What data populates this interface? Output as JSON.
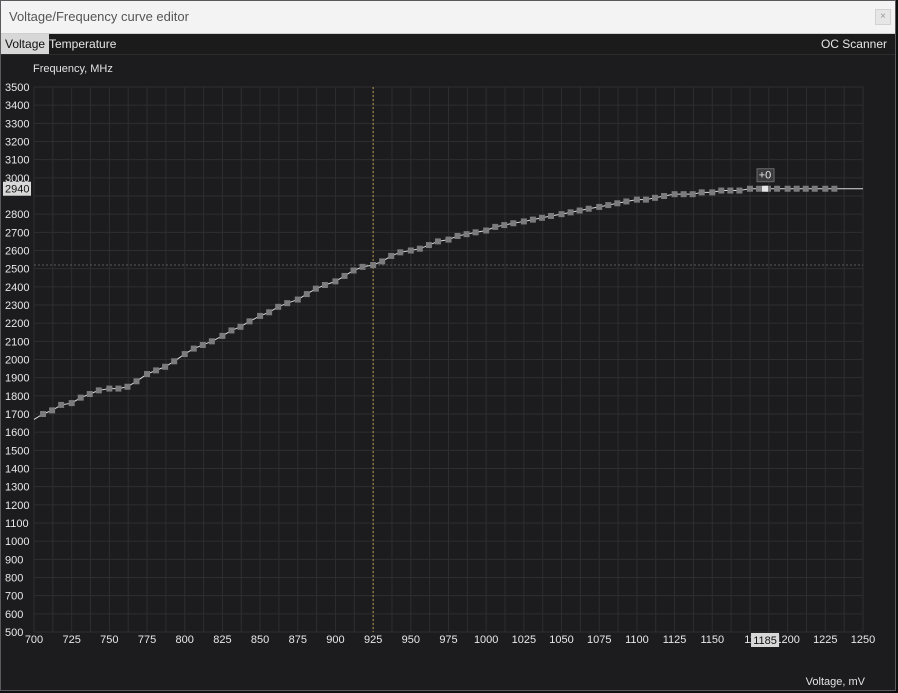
{
  "window": {
    "title": "Voltage/Frequency curve editor",
    "close_glyph": "×"
  },
  "tabs": [
    {
      "label": "Voltage",
      "active": true
    },
    {
      "label": "Temperature",
      "active": false
    }
  ],
  "oc_scanner": {
    "label": "OC Scanner"
  },
  "colors": {
    "background": "#1c1c1e",
    "grid": "#2e2e31",
    "curve": "#d9d9d9",
    "point": "#7b7b7d",
    "selected_point": "#e6e6e6",
    "crosshair": "#b4964a"
  },
  "chart_data": {
    "type": "line",
    "xlabel": "Voltage, mV",
    "ylabel": "Frequency, MHz",
    "xlim": [
      700,
      1250
    ],
    "ylim": [
      500,
      3500
    ],
    "x_ticks": [
      700,
      725,
      750,
      775,
      800,
      825,
      850,
      875,
      900,
      925,
      950,
      975,
      1000,
      1025,
      1050,
      1075,
      1100,
      1125,
      1150,
      1175,
      1200,
      1225,
      1250
    ],
    "x_tick_labels": [
      "700",
      "725",
      "750",
      "775",
      "800",
      "825",
      "850",
      "875",
      "900",
      "925",
      "950",
      "975",
      "1000",
      "1025",
      "1050",
      "1075",
      "1100",
      "1125",
      "1150",
      "11",
      "1200",
      "1225",
      "1250"
    ],
    "y_ticks": [
      500,
      600,
      700,
      800,
      900,
      1000,
      1100,
      1200,
      1300,
      1400,
      1500,
      1600,
      1700,
      1800,
      1900,
      2000,
      2100,
      2200,
      2300,
      2400,
      2500,
      2600,
      2700,
      2800,
      2900,
      3000,
      3100,
      3200,
      3300,
      3400,
      3500
    ],
    "grid": true,
    "x": [
      700,
      706,
      712,
      718,
      725,
      731,
      737,
      743,
      750,
      756,
      762,
      768,
      775,
      781,
      787,
      793,
      800,
      806,
      812,
      818,
      825,
      831,
      837,
      843,
      850,
      856,
      862,
      868,
      875,
      881,
      887,
      893,
      900,
      906,
      912,
      918,
      925,
      931,
      937,
      943,
      950,
      956,
      962,
      968,
      975,
      981,
      987,
      993,
      1000,
      1006,
      1012,
      1018,
      1025,
      1031,
      1037,
      1043,
      1050,
      1056,
      1062,
      1068,
      1075,
      1081,
      1087,
      1093,
      1100,
      1106,
      1112,
      1118,
      1125,
      1131,
      1137,
      1143,
      1150,
      1156,
      1162,
      1168,
      1175,
      1181,
      1187,
      1193,
      1200,
      1206,
      1212,
      1218,
      1225,
      1231,
      1237,
      1243,
      1250
    ],
    "y": [
      1670,
      1700,
      1720,
      1750,
      1760,
      1790,
      1810,
      1830,
      1840,
      1840,
      1850,
      1880,
      1920,
      1940,
      1960,
      1990,
      2030,
      2060,
      2080,
      2100,
      2130,
      2160,
      2180,
      2210,
      2240,
      2260,
      2290,
      2310,
      2330,
      2360,
      2390,
      2410,
      2430,
      2460,
      2490,
      2510,
      2520,
      2540,
      2570,
      2590,
      2600,
      2610,
      2630,
      2650,
      2660,
      2680,
      2690,
      2700,
      2710,
      2730,
      2740,
      2750,
      2760,
      2770,
      2780,
      2790,
      2800,
      2810,
      2820,
      2830,
      2840,
      2850,
      2860,
      2870,
      2880,
      2880,
      2890,
      2900,
      2910,
      2910,
      2910,
      2920,
      2920,
      2930,
      2930,
      2930,
      2940,
      2940,
      2940,
      2940,
      2940,
      2940,
      2940,
      2940,
      2940,
      2940,
      2940,
      2940,
      2940
    ],
    "marker_range": [
      1,
      85
    ],
    "selected_point": {
      "x": 1185,
      "y": 2940,
      "offset_label": "+0"
    },
    "crosshair": {
      "voltage": 925,
      "frequency": 2520
    },
    "highlight_labels": {
      "x": "1185",
      "y": "2940"
    }
  }
}
